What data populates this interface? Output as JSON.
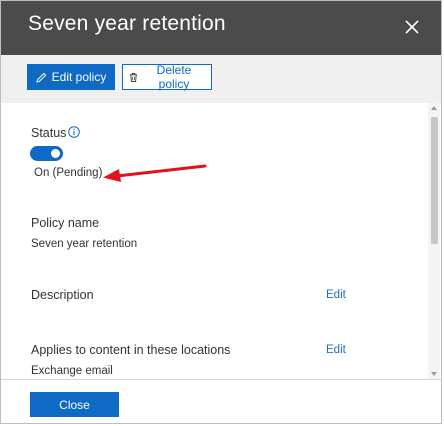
{
  "panel": {
    "title": "Seven year retention",
    "close_icon": "close-icon"
  },
  "toolbar": {
    "edit_label": "Edit policy",
    "edit_icon": "pencil-icon",
    "delete_label": "Delete policy",
    "delete_icon": "trash-icon"
  },
  "details": {
    "status_label": "Status",
    "status_info_icon": "info-icon",
    "status_on": true,
    "status_value": "On (Pending)",
    "policy_name_label": "Policy name",
    "policy_name_value": "Seven year retention",
    "description_label": "Description",
    "description_edit": "Edit",
    "locations_label": "Applies to content in these locations",
    "locations_edit": "Edit",
    "locations_value": "Exchange email"
  },
  "footer": {
    "close_label": "Close"
  },
  "colors": {
    "header_bg": "#4b4b4b",
    "toolbar_bg": "#f0f0f0",
    "accent": "#0e6ac4",
    "annotation_arrow": "#e0121a"
  }
}
